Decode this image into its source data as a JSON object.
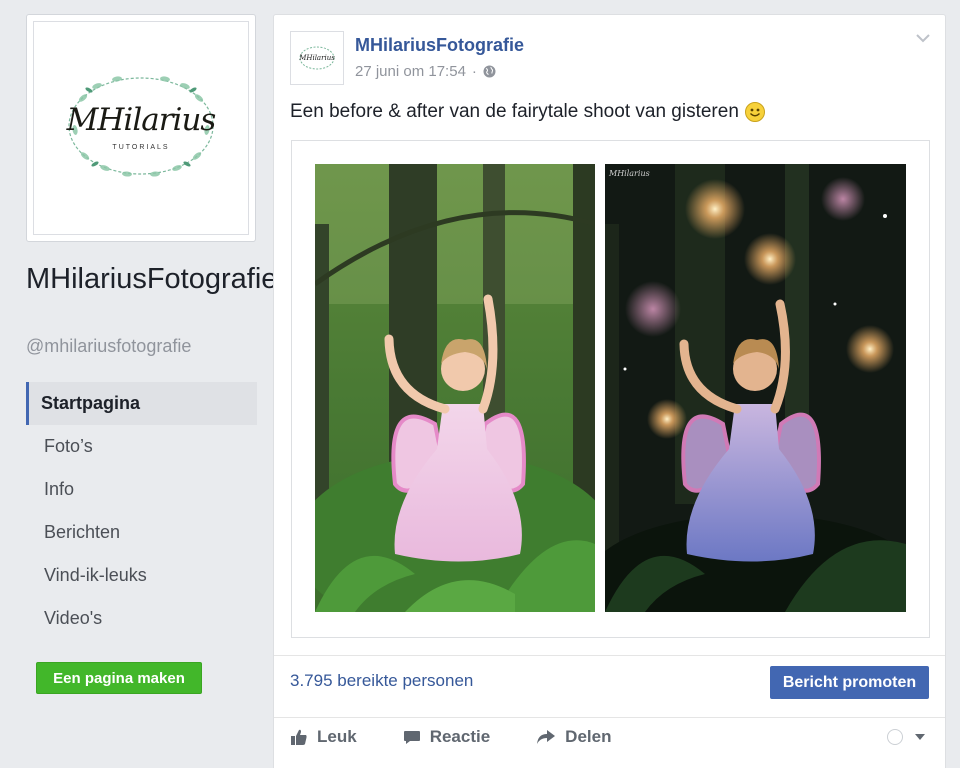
{
  "sidebar": {
    "logo": {
      "name": "MHilarius",
      "sub": "TUTORIALS"
    },
    "page_name": "MHilariusFotografie",
    "page_handle": "@mhilariusfotografie",
    "nav": [
      {
        "label": "Startpagina",
        "active": true
      },
      {
        "label": "Foto’s"
      },
      {
        "label": "Info"
      },
      {
        "label": "Berichten"
      },
      {
        "label": "Vind-ik-leuks"
      },
      {
        "label": "Video's"
      }
    ],
    "create_page_label": "Een pagina maken"
  },
  "post": {
    "author": "MHilariusFotografie",
    "timestamp": "27 juni om 17:54",
    "meta_separator": "·",
    "privacy_icon": "globe-icon",
    "text": "Een before & after van de fairytale shoot van gisteren",
    "emoji": "smiley",
    "watermark": "MHilarius",
    "reach": "3.795 bereikte personen",
    "promote_label": "Bericht promoten",
    "actions": {
      "like": "Leuk",
      "comment": "Reactie",
      "share": "Delen"
    }
  },
  "colors": {
    "background": "#e9ebee",
    "link": "#365899",
    "primary_button": "#4267b2",
    "create_button": "#42b72a",
    "muted_text": "#90949c"
  }
}
